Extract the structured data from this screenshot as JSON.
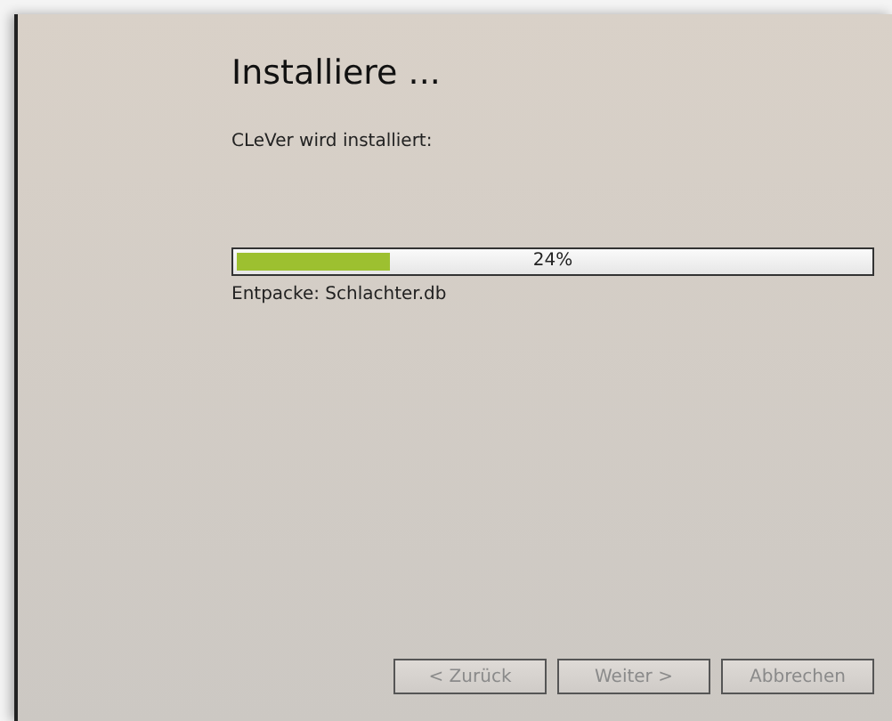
{
  "heading": "Installiere ...",
  "subtitle": "CLeVer wird installiert:",
  "progress": {
    "level": 0.24,
    "reading": "24%"
  },
  "status": "Entpacke: Schlachter.db",
  "buttons": [
    {
      "label": "< Zurück",
      "disabled": true
    },
    {
      "label": "Weiter >",
      "disabled": true
    },
    {
      "label": "Abbrechen",
      "disabled": true
    }
  ]
}
